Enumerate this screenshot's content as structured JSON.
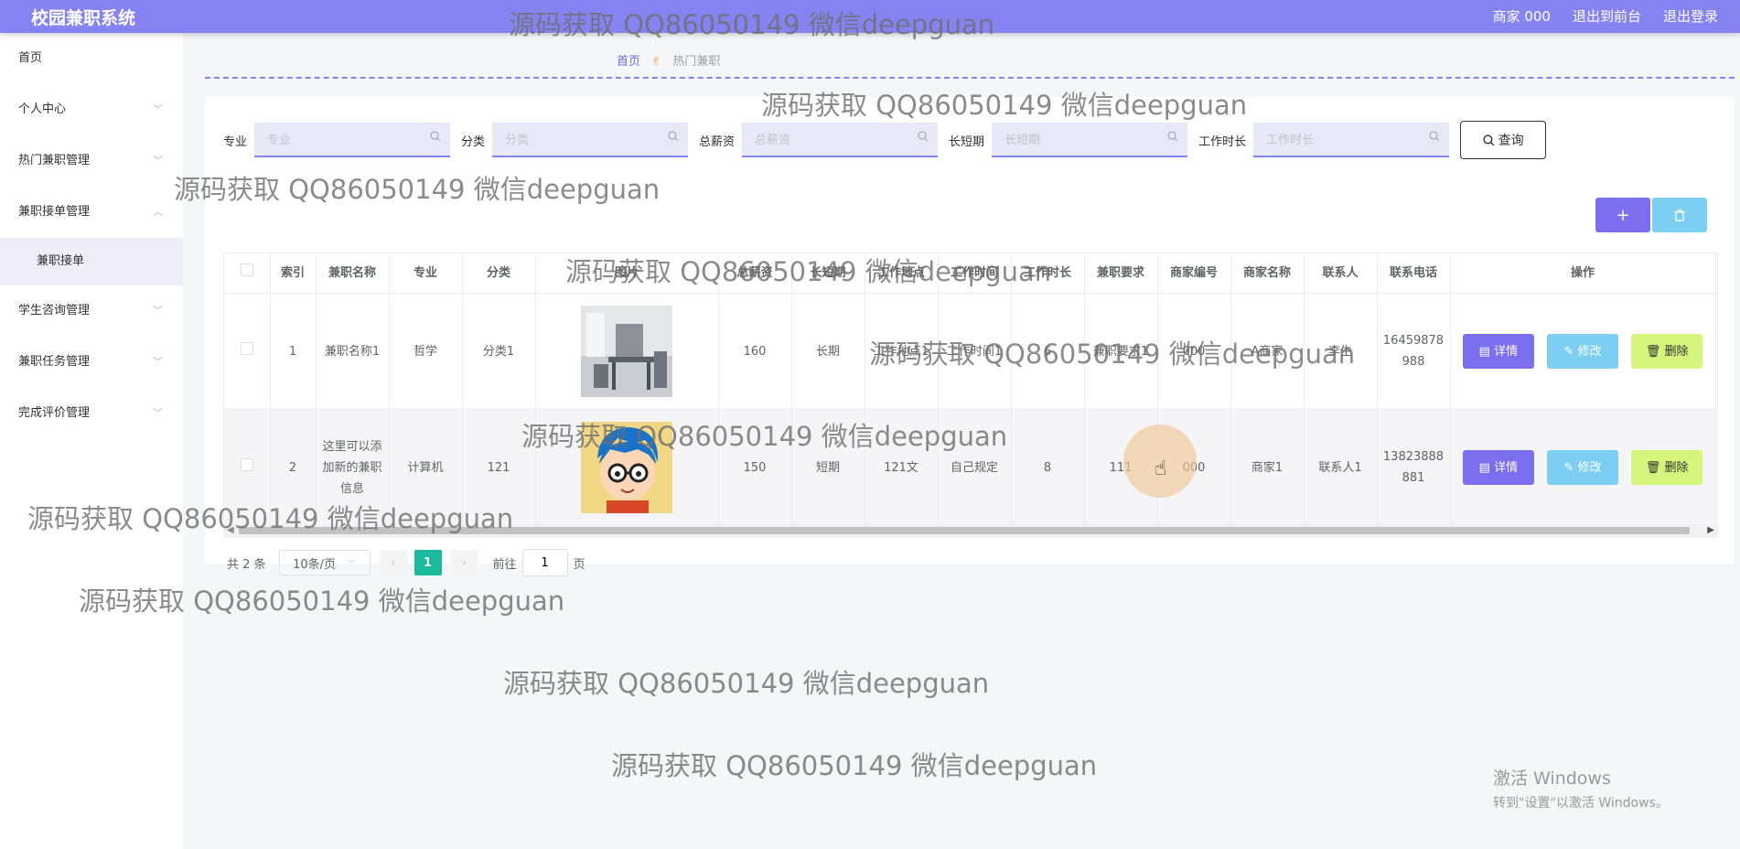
{
  "header": {
    "title": "校园兼职系统",
    "links": [
      "商家 000",
      "退出到前台",
      "退出登录"
    ]
  },
  "sidebar": {
    "items": [
      {
        "label": "首页",
        "chevron": false
      },
      {
        "label": "个人中心",
        "chevron": true
      },
      {
        "label": "热门兼职管理",
        "chevron": true
      },
      {
        "label": "兼职接单管理",
        "chevron": true,
        "expanded": true
      },
      {
        "label": "兼职接单",
        "sub": true
      },
      {
        "label": "学生咨询管理",
        "chevron": true
      },
      {
        "label": "兼职任务管理",
        "chevron": true
      },
      {
        "label": "完成评价管理",
        "chevron": true
      }
    ]
  },
  "breadcrumb": {
    "home": "首页",
    "current": "热门兼职"
  },
  "search": {
    "fields": [
      {
        "label": "专业",
        "placeholder": "专业"
      },
      {
        "label": "分类",
        "placeholder": "分类"
      },
      {
        "label": "总薪资",
        "placeholder": "总薪资"
      },
      {
        "label": "长短期",
        "placeholder": "长短期"
      },
      {
        "label": "工作时长",
        "placeholder": "工作时长"
      }
    ],
    "query_label": "查询"
  },
  "toolbar": {
    "add_icon": "+",
    "delete_icon": "trash-icon"
  },
  "table": {
    "columns": [
      "索引",
      "兼职名称",
      "专业",
      "分类",
      "图片",
      "总薪资",
      "长短期",
      "工作地点",
      "工作时间",
      "工作时长",
      "兼职要求",
      "商家编号",
      "商家名称",
      "联系人",
      "联系电话",
      "操作"
    ],
    "rows": [
      {
        "index": "1",
        "name": "兼职名称1",
        "major": "哲学",
        "category": "分类1",
        "image": "office-photo",
        "salary": "160",
        "term": "长期",
        "location": "工作地点1",
        "time": "工作时间1",
        "hours": "6",
        "requirement": "兼职要求1",
        "merchant_no": "000",
        "merchant_name": "A商家",
        "contact": "李生",
        "phone": "16459878988"
      },
      {
        "index": "2",
        "name": "这里可以添加新的兼职信息",
        "major": "计算机",
        "category": "121",
        "image": "cartoon-avatar",
        "salary": "150",
        "term": "短期",
        "location": "121文",
        "time": "自己规定",
        "hours": "8",
        "requirement": "111",
        "merchant_no": "000",
        "merchant_name": "商家1",
        "contact": "联系人1",
        "phone": "13823888881"
      }
    ],
    "actions": {
      "detail": "详情",
      "edit": "修改",
      "delete": "删除"
    }
  },
  "pagination": {
    "total": "共 2 条",
    "page_size": "10条/页",
    "current_page": "1",
    "goto_label": "前往",
    "goto_value": "1",
    "page_suffix": "页"
  },
  "watermarks": [
    "源码获取 QQ86050149 微信deepguan"
  ],
  "windows_activation": {
    "line1": "激活 Windows",
    "line2": "转到\"设置\"以激活 Windows。"
  }
}
